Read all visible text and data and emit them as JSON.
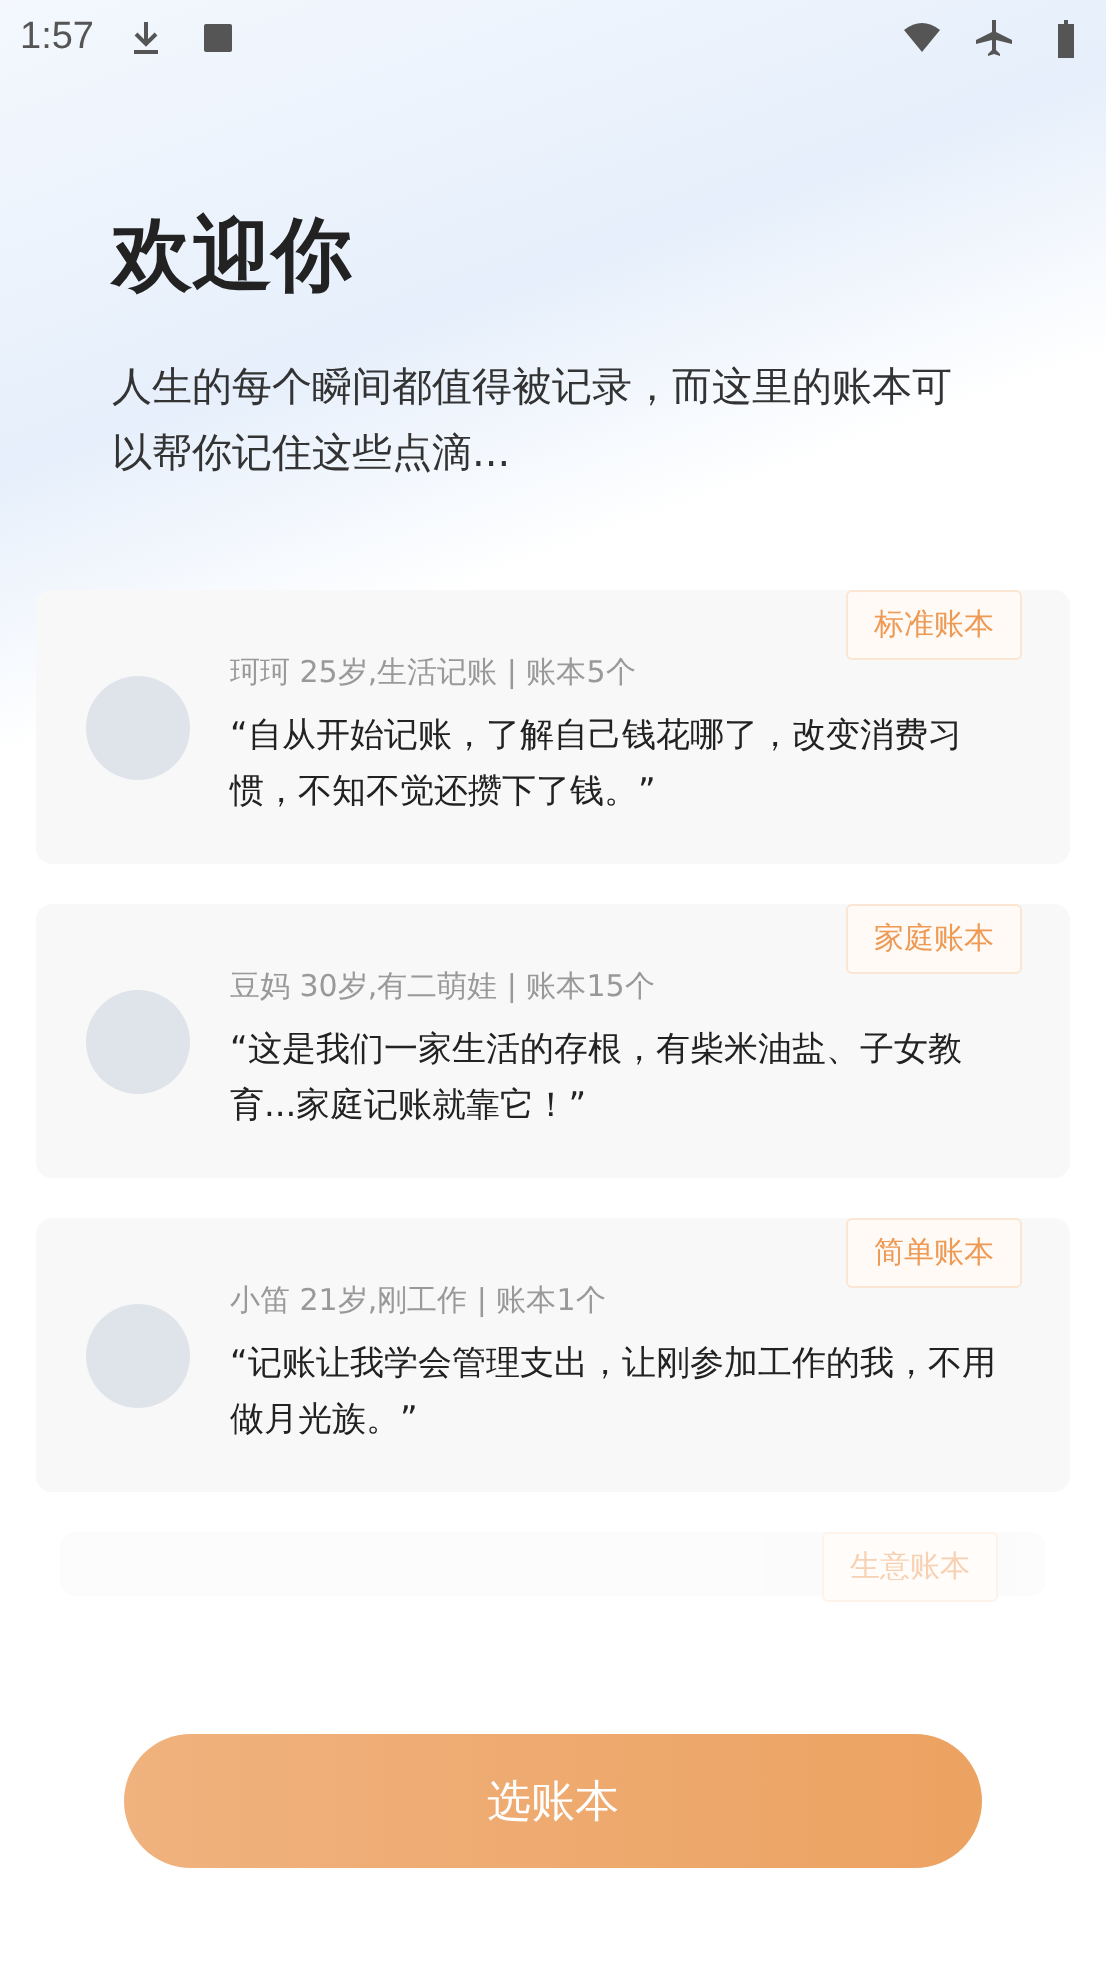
{
  "status_bar": {
    "time": "1:57"
  },
  "welcome": {
    "title": "欢迎你",
    "subtitle": "人生的每个瞬间都值得被记录，而这里的账本可以帮你记住这些点滴..."
  },
  "cards": [
    {
      "kind": "full",
      "tag": "标准账本",
      "meta": "珂珂 25岁,生活记账 | 账本5个",
      "quote": "“自从开始记账，了解自己钱花哪了，改变消费习惯，不知不觉还攒下了钱。”"
    },
    {
      "kind": "full",
      "tag": "家庭账本",
      "meta": "豆妈 30岁,有二萌娃 | 账本15个",
      "quote": "“这是我们一家生活的存根，有柴米油盐、子女教育...家庭记账就靠它！”"
    },
    {
      "kind": "full",
      "tag": "简单账本",
      "meta": "小笛 21岁,刚工作 | 账本1个",
      "quote": "“记账让我学会管理支出，让刚参加工作的我，不用做月光族。”"
    },
    {
      "kind": "faded",
      "tag": "生意账本"
    }
  ],
  "button": {
    "label": "选账本"
  }
}
